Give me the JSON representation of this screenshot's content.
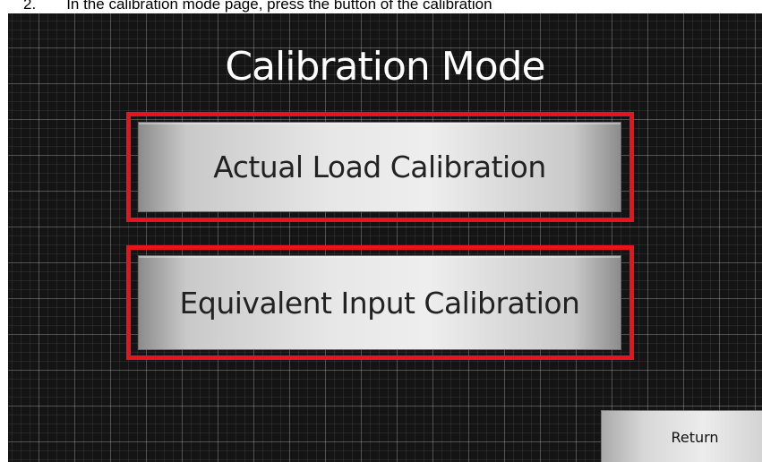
{
  "caption": {
    "step_number": "2.",
    "text": "In the calibration mode page, press the button of the calibration"
  },
  "screen": {
    "title": "Calibration Mode",
    "buttons": {
      "actual_load": "Actual Load Calibration",
      "equivalent_input": "Equivalent Input Calibration",
      "return": "Return"
    },
    "highlight_color": "#e8141c"
  }
}
